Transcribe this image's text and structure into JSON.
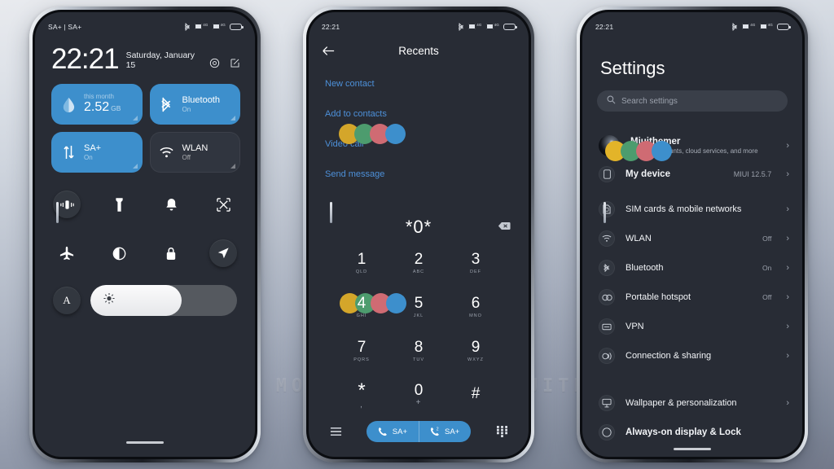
{
  "watermark": "VISIT  FOR  MORE  THEMES  -  MIUITHEMER.COM",
  "colors": {
    "accent_blue": "#3d8fcc",
    "link_blue": "#4d90d9",
    "screen_bg": "#282c35",
    "tile_off": "#30353f",
    "blob_yellow": "#d4a62a",
    "blob_green": "#4d9c6e",
    "blob_red": "#cf6b73",
    "blob_blue": "#3d8fcc"
  },
  "phone1": {
    "statusbar": {
      "left": "SA+ | SA+",
      "net1": "4G",
      "net2": "4G"
    },
    "clock": {
      "time": "22:21",
      "date": "Saturday, January 15"
    },
    "header_icons": [
      "settings-gear-icon",
      "edit-pencil-icon"
    ],
    "tiles": [
      {
        "name": "data-usage",
        "state": "on",
        "top": "this month",
        "big": "2.52",
        "unit": "GB",
        "icon": "data-drop-icon"
      },
      {
        "name": "bluetooth",
        "state": "on",
        "label": "Bluetooth",
        "sub": "On",
        "icon": "bluetooth-icon"
      },
      {
        "name": "mobile-data",
        "state": "on",
        "label": "SA+",
        "sub": "On",
        "icon": "data-arrows-icon"
      },
      {
        "name": "wlan",
        "state": "off",
        "label": "WLAN",
        "sub": "Off",
        "icon": "wifi-icon"
      }
    ],
    "quick_toggles_row1": [
      "vibrate-icon",
      "flashlight-icon",
      "bell-icon",
      "screenshot-icon"
    ],
    "quick_toggles_row2": [
      "airplane-icon",
      "dark-mode-icon",
      "lock-icon",
      "location-icon"
    ],
    "brightness": {
      "auto_label": "A",
      "value_percent": 62,
      "icon": "sun-brightness-icon"
    }
  },
  "phone2": {
    "statusbar": {
      "left": "22:21",
      "net1": "4G",
      "net2": "4G"
    },
    "header": {
      "title": "Recents",
      "back_icon": "arrow-left-icon"
    },
    "links": [
      "New contact",
      "Add to contacts",
      "Video call",
      "Send message"
    ],
    "dialed_number": "*0*",
    "delete_icon": "backspace-icon",
    "keypad": [
      {
        "num": "1",
        "letters": "QLD"
      },
      {
        "num": "2",
        "letters": "ABC"
      },
      {
        "num": "3",
        "letters": "DEF"
      },
      {
        "num": "4",
        "letters": "GHI"
      },
      {
        "num": "5",
        "letters": "JKL"
      },
      {
        "num": "6",
        "letters": "MNO"
      },
      {
        "num": "7",
        "letters": "PQRS"
      },
      {
        "num": "8",
        "letters": "TUV"
      },
      {
        "num": "9",
        "letters": "WXYZ"
      },
      {
        "num": "*",
        "letters": ","
      },
      {
        "num": "0",
        "letters": "+"
      },
      {
        "num": "#",
        "letters": ""
      }
    ],
    "bottom": {
      "menu_icon": "menu-lines-icon",
      "keypad_icon": "dialpad-grid-icon",
      "call_buttons": [
        {
          "label": "SA+",
          "icon": "call-sim1-icon"
        },
        {
          "label": "SA+",
          "icon": "call-sim2-icon"
        }
      ]
    }
  },
  "phone3": {
    "statusbar": {
      "left": "22:21",
      "net1": "4G",
      "net2": "4G"
    },
    "page_title": "Settings",
    "search": {
      "placeholder": "Search settings",
      "icon": "search-icon"
    },
    "account": {
      "name": "Miuithemer",
      "subtitle": "Manage accounts, cloud services, and more"
    },
    "items": [
      {
        "label": "My device",
        "value": "MIUI 12.5.7",
        "icon": "phone-device-icon"
      },
      {
        "label": "SIM cards & mobile networks",
        "value": "",
        "icon": "sim-card-icon"
      },
      {
        "label": "WLAN",
        "value": "Off",
        "icon": "wifi-icon"
      },
      {
        "label": "Bluetooth",
        "value": "On",
        "icon": "bluetooth-icon"
      },
      {
        "label": "Portable hotspot",
        "value": "Off",
        "icon": "hotspot-icon"
      },
      {
        "label": "VPN",
        "value": "",
        "icon": "vpn-icon"
      },
      {
        "label": "Connection & sharing",
        "value": "",
        "icon": "connection-sharing-icon"
      },
      {
        "label": "Wallpaper & personalization",
        "value": "",
        "icon": "wallpaper-icon"
      },
      {
        "label": "Always-on display & Lock",
        "value": "",
        "icon": "aod-lock-icon"
      }
    ]
  }
}
